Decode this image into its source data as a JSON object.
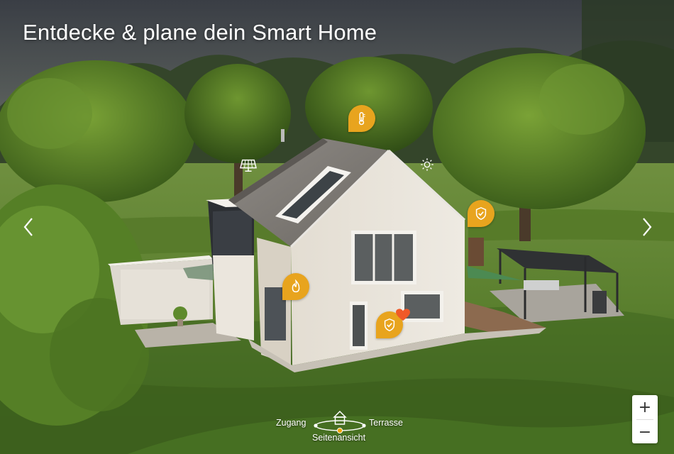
{
  "title": "Entdecke & plane dein Smart Home",
  "colors": {
    "accent": "#f0a500",
    "heart": "#f05a28",
    "text": "#ffffff"
  },
  "navigation": {
    "prev_icon": "chevron-left-icon",
    "next_icon": "chevron-right-icon"
  },
  "hotspots": [
    {
      "name": "thermometer",
      "icon": "thermometer-icon"
    },
    {
      "name": "solar-panel",
      "icon": "solar-panel-icon"
    },
    {
      "name": "sun",
      "icon": "sun-icon"
    },
    {
      "name": "security-shield",
      "icon": "shield-check-icon"
    },
    {
      "name": "heating-flame",
      "icon": "flame-icon"
    },
    {
      "name": "security-favorite",
      "icon": "shield-check-icon",
      "badge": "heart-icon"
    }
  ],
  "view_switcher": {
    "left_label": "Zugang",
    "right_label": "Terrasse",
    "current_label": "Seitenansicht",
    "icon": "house-icon"
  },
  "zoom": {
    "in_label": "+",
    "out_label": "−"
  }
}
